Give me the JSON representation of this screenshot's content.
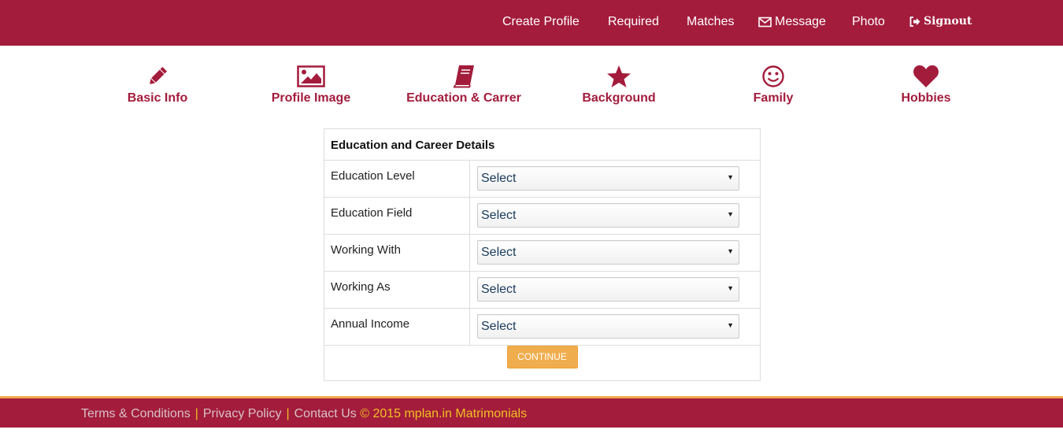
{
  "topnav": {
    "create_profile": "Create Profile",
    "required": "Required",
    "matches": "Matches",
    "message": "Message",
    "photo": "Photo",
    "signout": "Signout"
  },
  "steps": [
    {
      "label": "Basic Info",
      "icon": "pencil-icon"
    },
    {
      "label": "Profile Image",
      "icon": "image-icon"
    },
    {
      "label": "Education & Carrer",
      "icon": "book-icon"
    },
    {
      "label": "Background",
      "icon": "star-icon"
    },
    {
      "label": "Family",
      "icon": "smile-icon"
    },
    {
      "label": "Hobbies",
      "icon": "heart-icon"
    }
  ],
  "form": {
    "title": "Education and Career Details",
    "rows": [
      {
        "label": "Education Level",
        "value": "Select"
      },
      {
        "label": "Education Field",
        "value": "Select"
      },
      {
        "label": "Working With",
        "value": "Select"
      },
      {
        "label": "Working As",
        "value": "Select"
      },
      {
        "label": "Annual Income",
        "value": "Select"
      }
    ],
    "continue_label": "CONTINUE"
  },
  "footer": {
    "terms": "Terms & Conditions",
    "privacy": "Privacy Policy",
    "contact": "Contact Us",
    "separator": "|",
    "copyright": "© 2015 mplan.in Matrimonials"
  },
  "colors": {
    "brand": "#a31c3c",
    "accent": "#f0ad4e",
    "footer_highlight": "#f0c020"
  }
}
